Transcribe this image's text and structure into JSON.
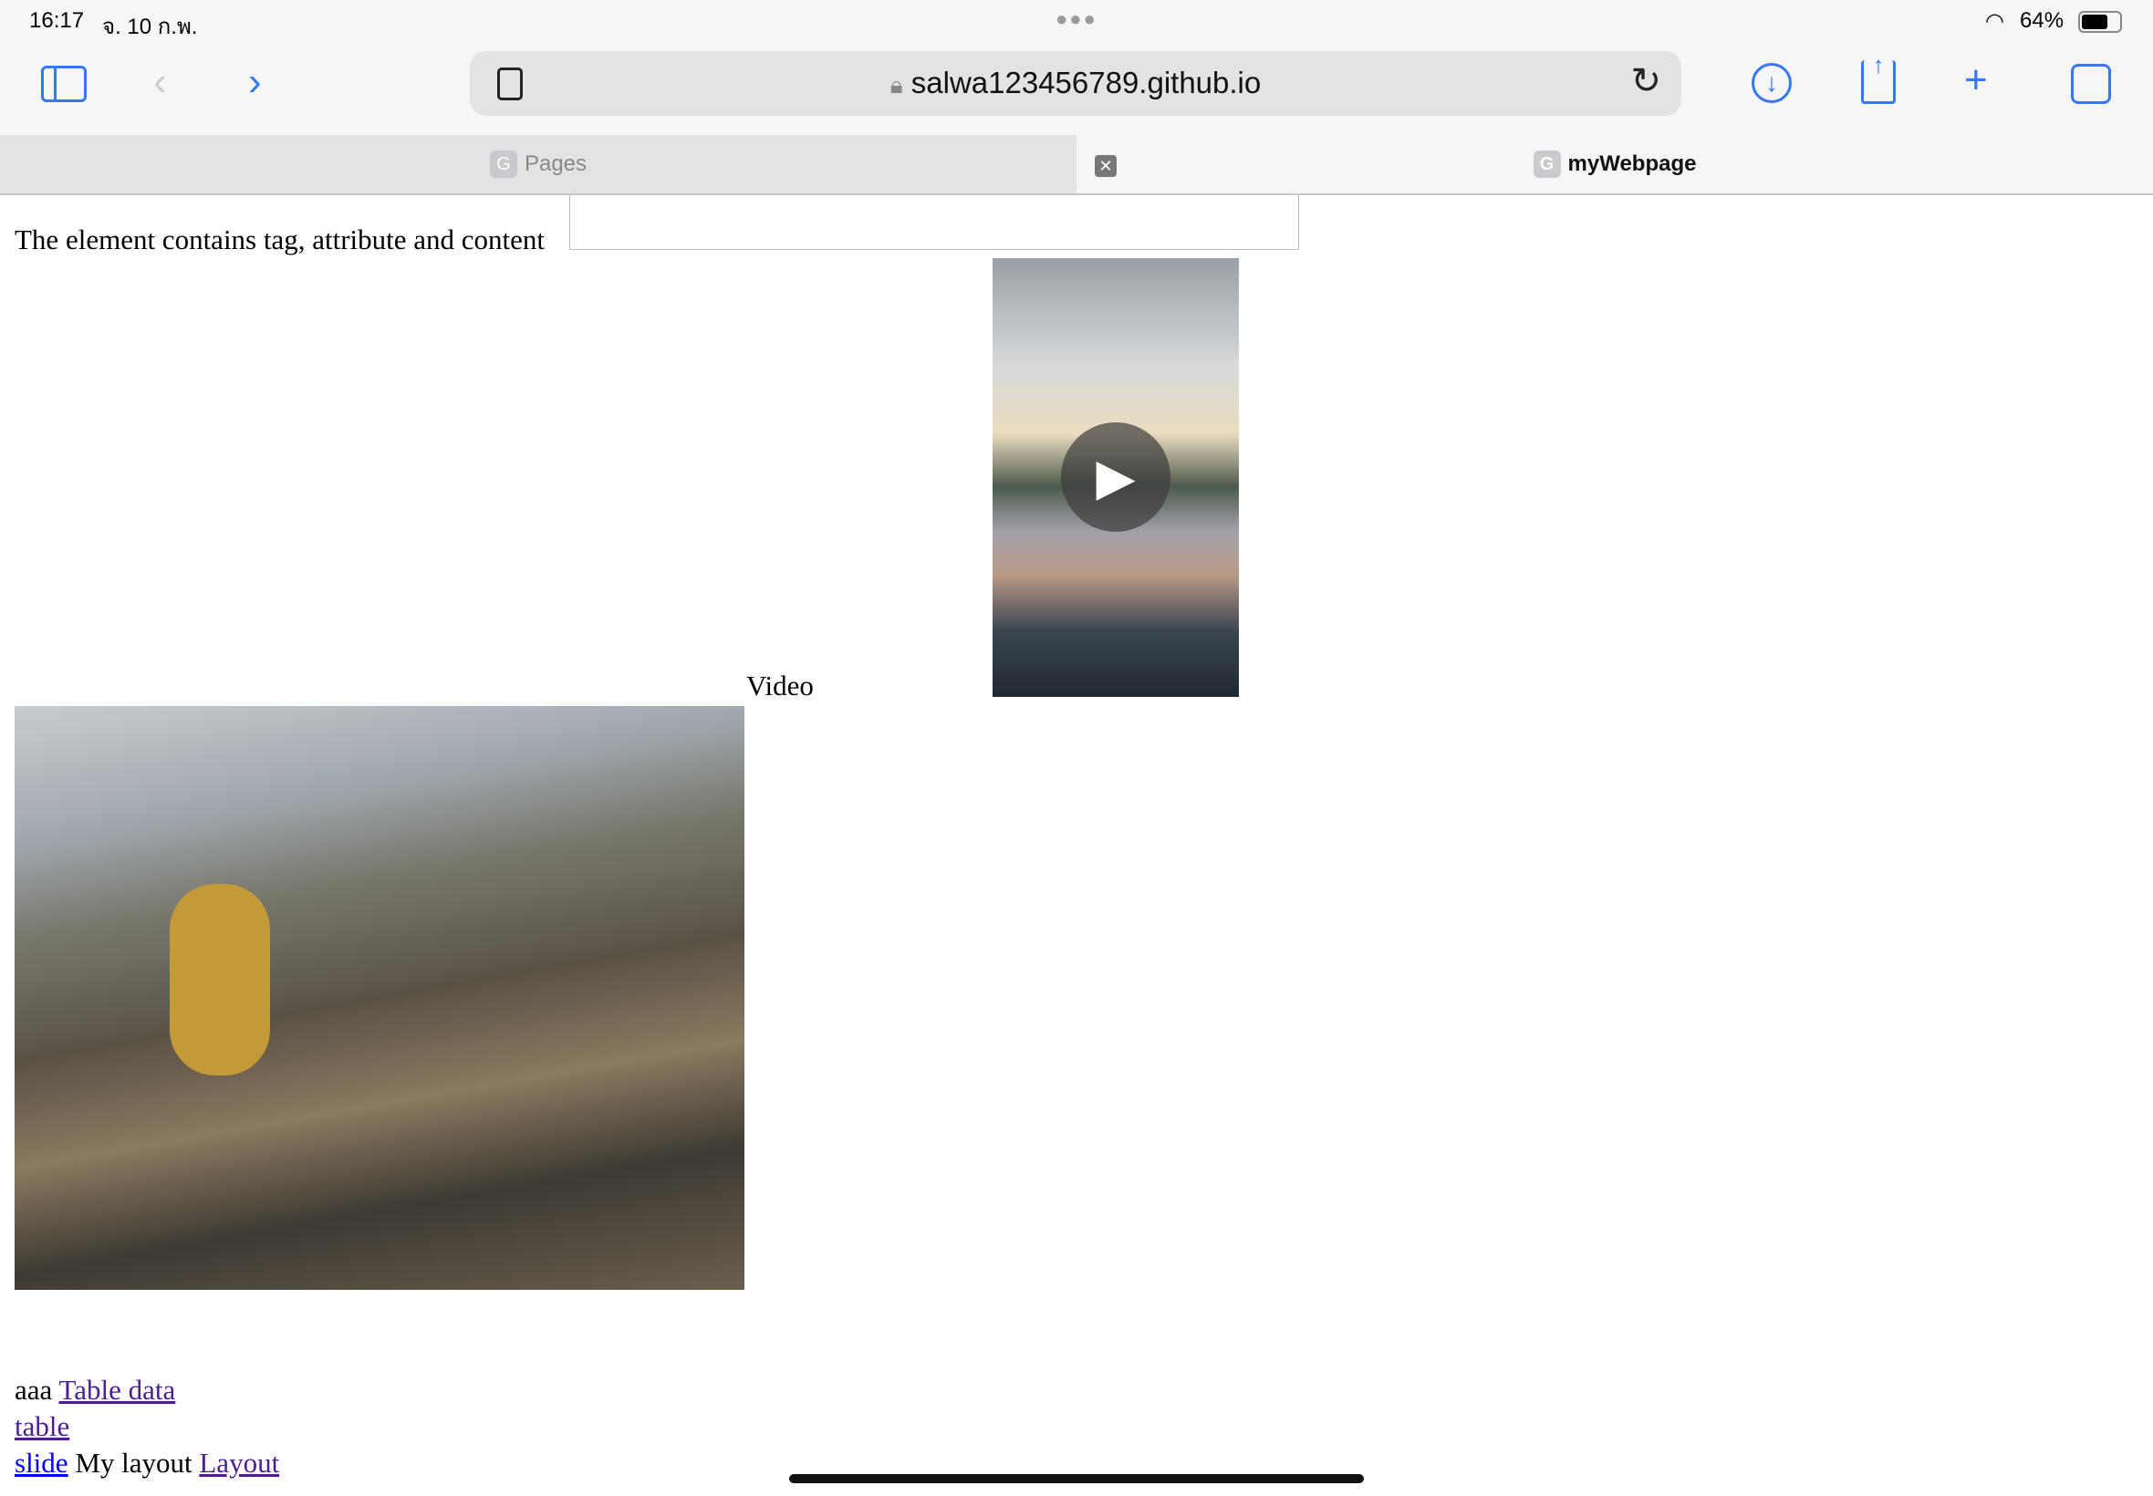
{
  "status": {
    "time": "16:17",
    "date": "จ. 10 ก.พ.",
    "battery": "64%"
  },
  "browser": {
    "url": "salwa123456789.github.io"
  },
  "tabs": [
    {
      "label": "Pages",
      "favicon": "G",
      "active": false
    },
    {
      "label": "myWebpage",
      "favicon": "G",
      "active": true
    }
  ],
  "page": {
    "intro": "The element contains tag, attribute and content",
    "video_label": "Video",
    "line1_text": "aaa",
    "link_table_data": "Table data",
    "link_table": "table",
    "link_slide": "slide",
    "line3_text": "My layout",
    "link_layout": "Layout"
  }
}
